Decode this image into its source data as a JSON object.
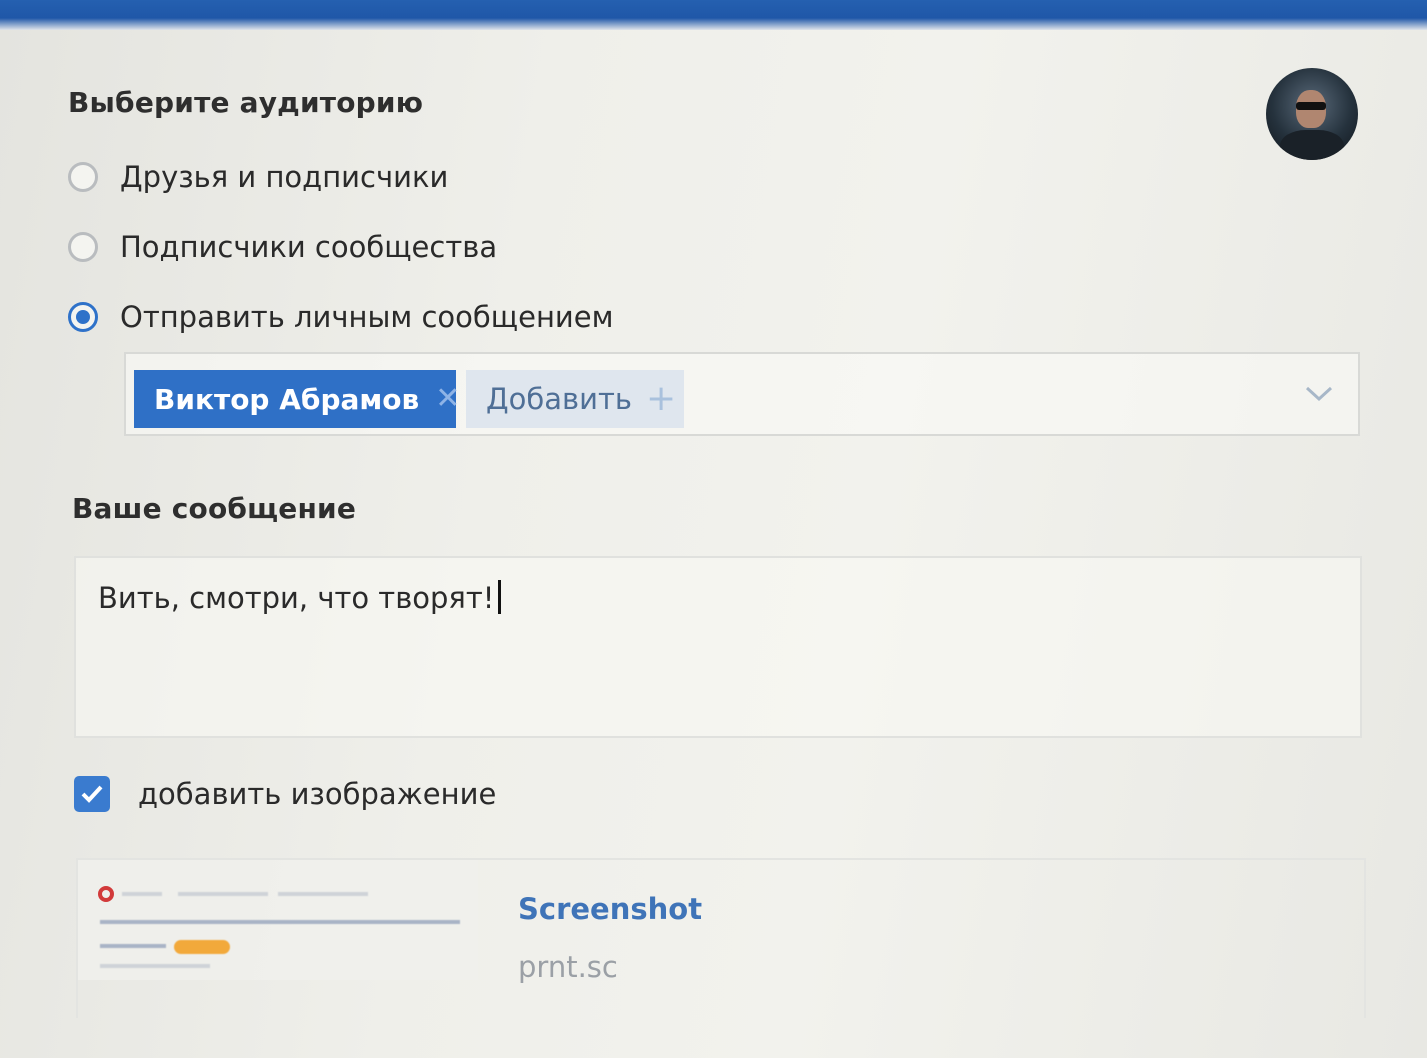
{
  "audience": {
    "title": "Выберите аудиторию",
    "options": [
      {
        "label": "Друзья и подписчики",
        "selected": false
      },
      {
        "label": "Подписчики сообщества",
        "selected": false
      },
      {
        "label": "Отправить личным сообщением",
        "selected": true
      }
    ]
  },
  "recipients": {
    "chips": [
      {
        "label": "Виктор Абрамов",
        "close_icon": "✕"
      }
    ],
    "add_label": "Добавить",
    "add_icon": "+"
  },
  "message": {
    "title": "Ваше сообщение",
    "value": "Вить, смотри, что творят!"
  },
  "attach_image": {
    "label": "добавить изображение",
    "checked": true
  },
  "link_preview": {
    "title": "Screenshot",
    "domain": "prnt.sc"
  },
  "colors": {
    "accent": "#2f70c6",
    "top_bar": "#2560b0"
  }
}
